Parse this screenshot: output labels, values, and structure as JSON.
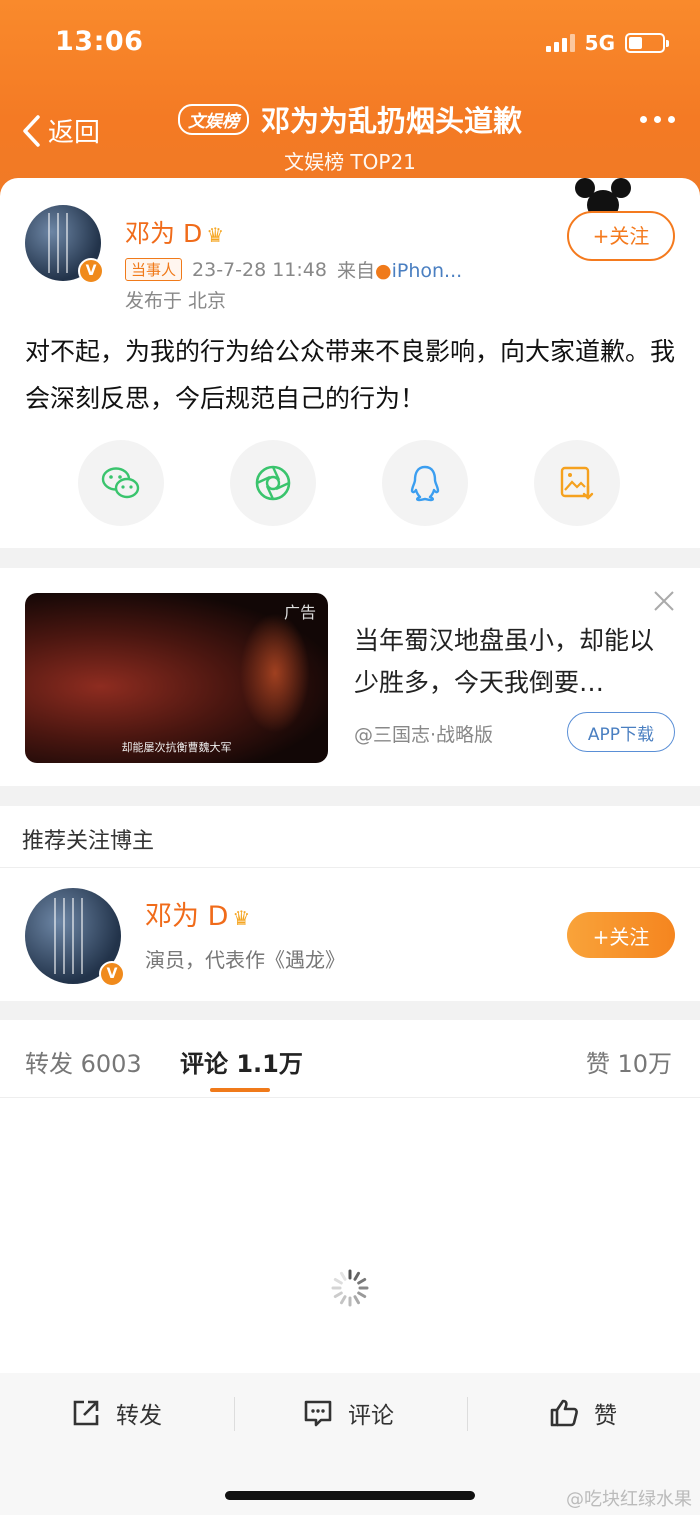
{
  "status_bar": {
    "time": "13:06",
    "network": "5G",
    "battery_level": 0.4
  },
  "header": {
    "back_label": "返回",
    "tag": "文娱榜",
    "title": "邓为为乱扔烟头道歉",
    "subtitle": "文娱榜 TOP21"
  },
  "post": {
    "author": "邓为 D",
    "role_tag": "当事人",
    "time": "23-7-28 11:48",
    "source_prefix": "来自",
    "source": "iPhon...",
    "location": "发布于 北京",
    "follow_label": "+关注",
    "content": "对不起，为我的行为给公众带来不良影响，向大家道歉。我会深刻反思，今后规范自己的行为！",
    "share_icons": [
      "wechat-icon",
      "moments-icon",
      "qq-icon",
      "save-image-icon"
    ]
  },
  "ad": {
    "label": "广告",
    "caption": "却能屡次抗衡曹魏大军",
    "text": "当年蜀汉地盘虽小，却能以少胜多，今天我倒要…",
    "account": "@三国志·战略版",
    "button": "APP下载"
  },
  "recommend": {
    "title": "推荐关注博主",
    "name": "邓为 D",
    "desc": "演员，代表作《遇龙》",
    "follow_label": "+关注"
  },
  "tabs": {
    "repost": "转发 6003",
    "comment": "评论 1.1万",
    "like": "赞 10万"
  },
  "bottom_bar": {
    "repost": "转发",
    "comment": "评论",
    "like": "赞"
  },
  "watermark": "@吃块红绿水果",
  "colors": {
    "brand_orange": "#f47a24",
    "link_blue": "#4a7fc1"
  }
}
